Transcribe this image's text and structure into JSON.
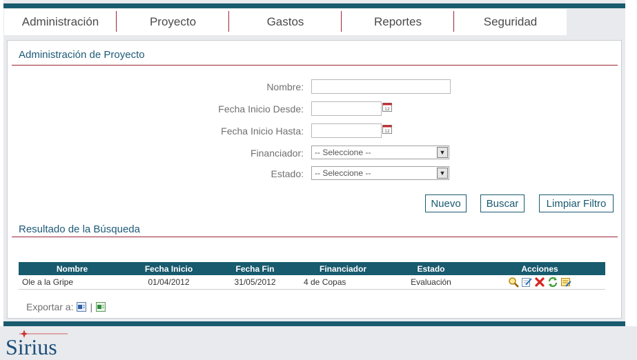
{
  "menu": {
    "items": [
      "Administración",
      "Proyecto",
      "Gastos",
      "Reportes",
      "Seguridad"
    ]
  },
  "page": {
    "title": "Administración de Proyecto"
  },
  "filters": {
    "nombre_label": "Nombre:",
    "nombre_value": "",
    "fecha_desde_label": "Fecha Inicio Desde:",
    "fecha_desde_value": "",
    "fecha_hasta_label": "Fecha Inicio Hasta:",
    "fecha_hasta_value": "",
    "financiador_label": "Financiador:",
    "financiador_selected": "-- Seleccione --",
    "estado_label": "Estado:",
    "estado_selected": "-- Seleccione --"
  },
  "buttons": {
    "nuevo": "Nuevo",
    "buscar": "Buscar",
    "limpiar": "Limpiar Filtro"
  },
  "results": {
    "title": "Resultado de la Búsqueda",
    "columns": [
      "Nombre",
      "Fecha Inicio",
      "Fecha Fin",
      "Financiador",
      "Estado",
      "Acciones"
    ],
    "rows": [
      {
        "nombre": "Ole a la Gripe",
        "fecha_inicio": "01/04/2012",
        "fecha_fin": "31/05/2012",
        "financiador": "4 de Copas",
        "estado": "Evaluación"
      }
    ]
  },
  "export": {
    "label": "Exportar a:",
    "separator": "|"
  },
  "brand": {
    "logo_text": "Sirius",
    "primary_color": "#185a6e",
    "accent_color": "#9b2335"
  }
}
